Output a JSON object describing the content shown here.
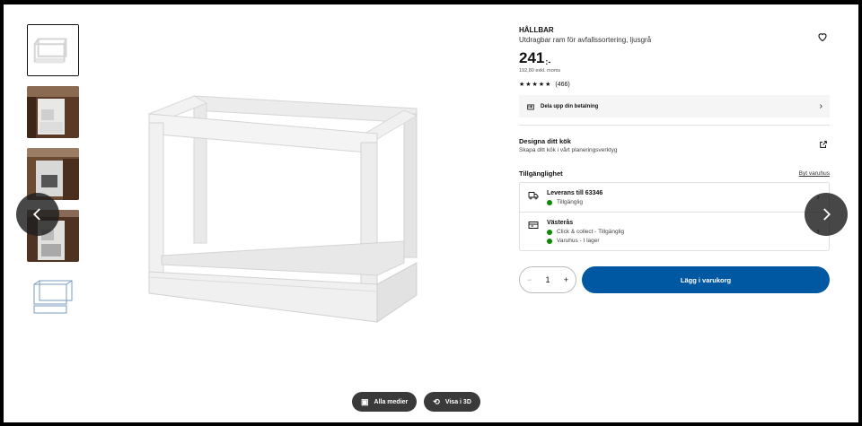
{
  "product": {
    "brand": "HÅLLBAR",
    "description": "Utdragbar ram för avfallssortering, ljusgrå",
    "price_main": "241",
    "price_suffix": ":-",
    "price_ex_vat": "192,80 exkl. moms",
    "rating_stars": "★★★★★",
    "rating_count": "(466)",
    "rating_value": 4.6
  },
  "payment": {
    "label": "Dela upp din betalning"
  },
  "design": {
    "title": "Designa ditt kök",
    "subtitle": "Skapa ditt kök i vårt planeringsverktyg"
  },
  "availability": {
    "title": "Tillgänglighet",
    "change_store": "Byt varuhus",
    "delivery": {
      "title": "Leverans till 63346",
      "status": "Tillgänglig"
    },
    "store": {
      "title": "Västerås",
      "status_1": "Click & collect - Tillgänglig",
      "status_2": "Varuhus - I lager"
    }
  },
  "cart": {
    "quantity": "1",
    "minus": "−",
    "plus": "+",
    "button": "Lägg i varukorg"
  },
  "media": {
    "all_media": "Alla medier",
    "view_3d": "Visa i 3D"
  },
  "icons": [
    "heart-icon",
    "payment-icon",
    "external-link-icon",
    "truck-icon",
    "store-icon",
    "chevron-left-icon",
    "chevron-right-icon"
  ],
  "colors": {
    "primary": "#0058a3",
    "in_stock": "#0a8a00"
  }
}
